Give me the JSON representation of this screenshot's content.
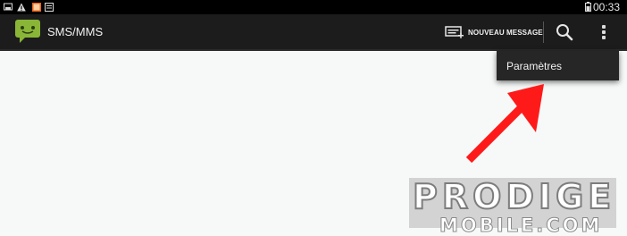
{
  "status_bar": {
    "time": "00:33",
    "icons": [
      "screenshot-icon",
      "warning-icon",
      "gallery-icon",
      "dialog-icon",
      "battery-icon"
    ]
  },
  "action_bar": {
    "app_title": "SMS/MMS",
    "app_icon": "sms-bubble-icon",
    "new_message_label": "NOUVEAU MESSAGE",
    "new_message_icon": "compose-icon",
    "search_icon": "search-icon",
    "overflow_icon": "overflow-menu-icon"
  },
  "overflow_menu": {
    "items": [
      {
        "label": "Paramètres"
      }
    ]
  },
  "annotation": {
    "arrow_color": "#ff1a1a"
  },
  "watermark": {
    "line1": "PRODIGE",
    "line2": "MOBILE.COM"
  },
  "colors": {
    "accent_green": "#8ab637",
    "action_bar": "#1c1c1c",
    "status_bar": "#000000"
  }
}
